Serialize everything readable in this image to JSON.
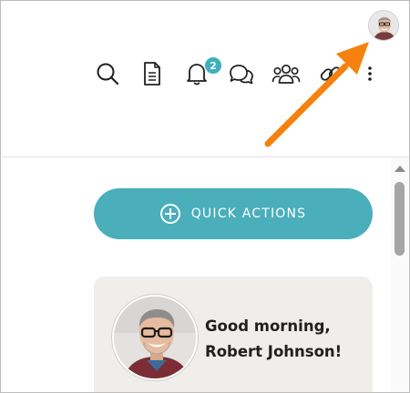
{
  "header": {
    "user_avatar": {
      "icon": "user-avatar-photo"
    },
    "toolbar": [
      {
        "id": "search",
        "icon": "search-icon"
      },
      {
        "id": "documents",
        "icon": "document-icon"
      },
      {
        "id": "notifications",
        "icon": "bell-icon",
        "badge": "2"
      },
      {
        "id": "messages",
        "icon": "chat-bubbles-icon"
      },
      {
        "id": "people",
        "icon": "group-icon"
      },
      {
        "id": "links",
        "icon": "link-icon"
      },
      {
        "id": "more",
        "icon": "kebab-menu-icon"
      }
    ]
  },
  "main": {
    "quick_actions": {
      "label": "QUICK ACTIONS",
      "icon": "plus-circle-icon"
    },
    "greeting": {
      "line1": "Good morning,",
      "line2": "Robert Johnson!",
      "avatar": "user-avatar-photo"
    }
  },
  "annotation": {
    "icon": "orange-arrow",
    "color": "#f5820f"
  },
  "colors": {
    "accent": "#4aaebb",
    "badge": "#3fb0bd",
    "card_bg": "#efeeea",
    "icon": "#1f1f1f"
  }
}
